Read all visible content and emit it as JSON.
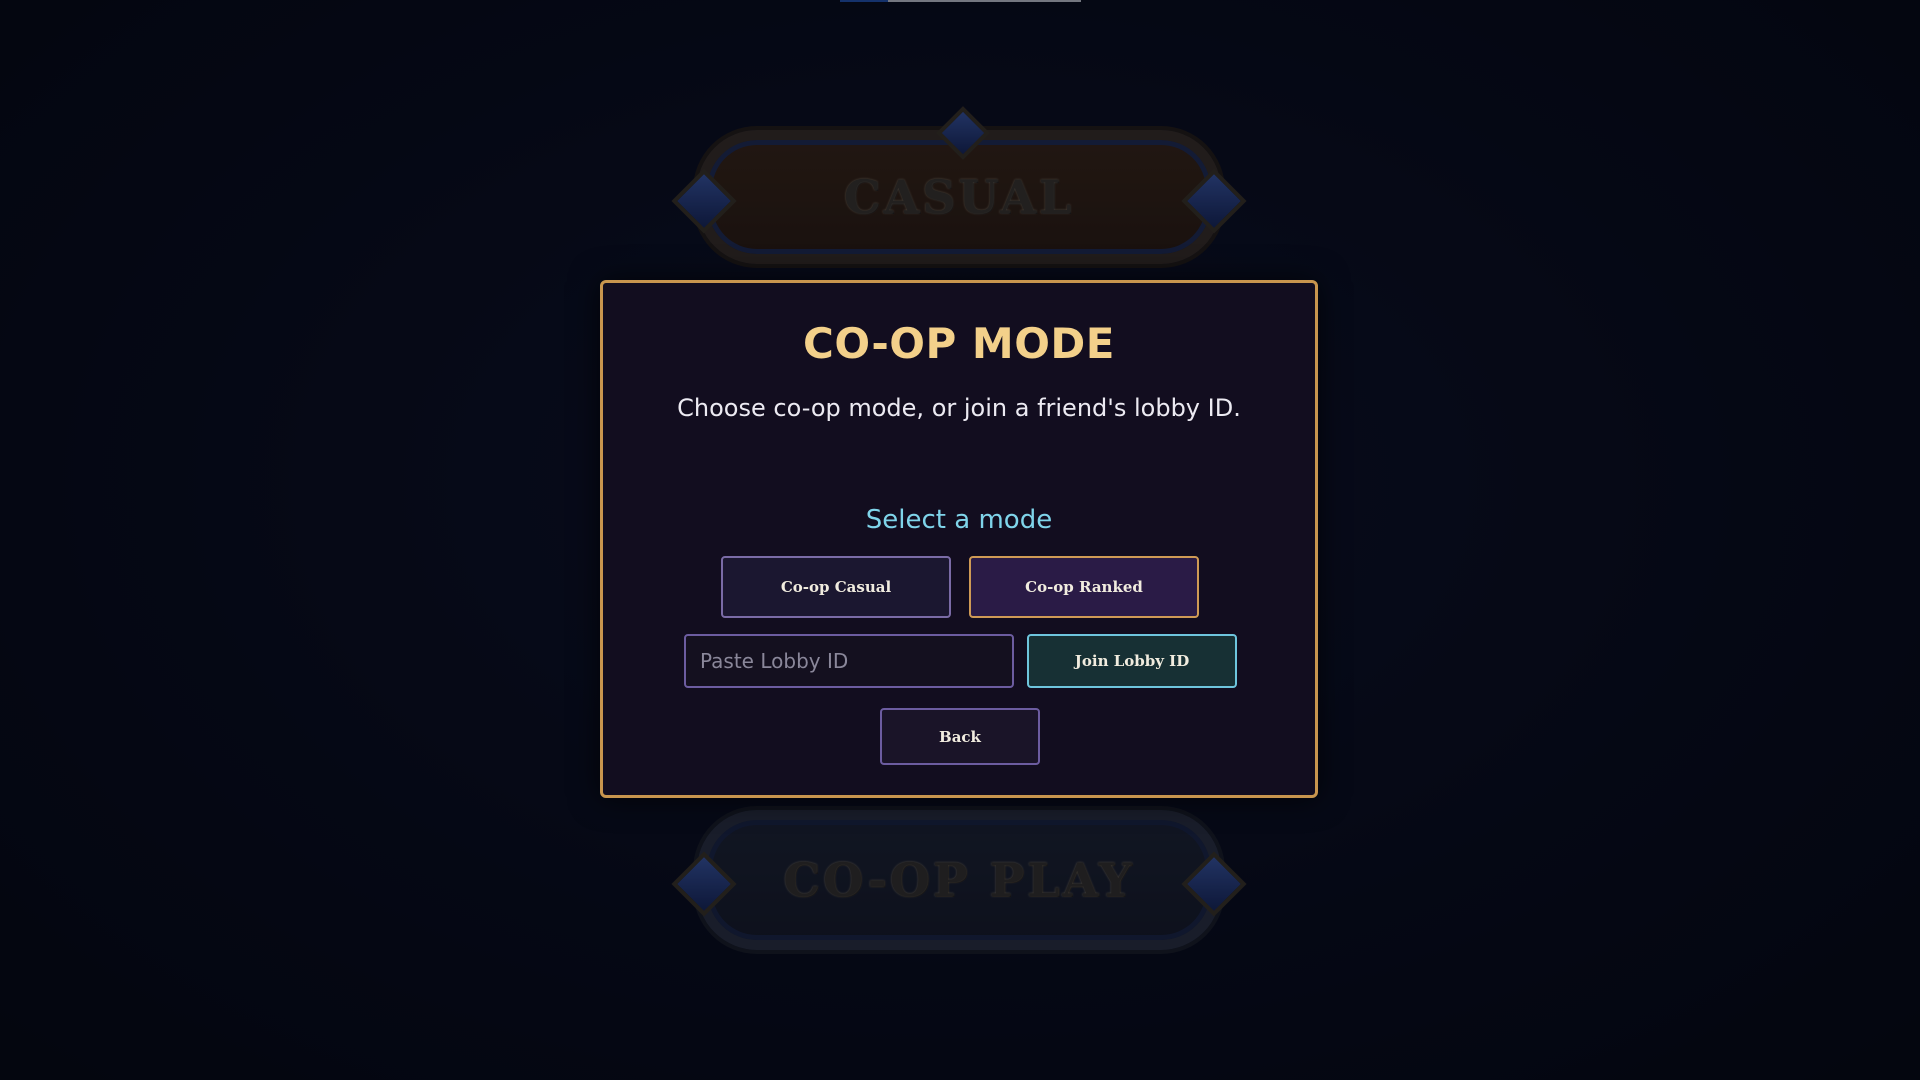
{
  "background": {
    "top_plaque_label": "CASUAL",
    "bottom_plaque_label": "CO-OP PLAY"
  },
  "modal": {
    "title": "CO-OP MODE",
    "subtitle": "Choose co-op mode, or join a friend's lobby ID.",
    "mode_label": "Select a mode",
    "casual_button": "Co-op Casual",
    "ranked_button": "Co-op Ranked",
    "lobby_placeholder": "Paste Lobby ID",
    "lobby_value": "",
    "join_button": "Join Lobby ID",
    "back_button": "Back"
  },
  "colors": {
    "accent_gold": "#f3d08a",
    "modal_border": "#c8954e",
    "mode_label": "#7fd4ea",
    "join_border": "#6ec5dd"
  }
}
